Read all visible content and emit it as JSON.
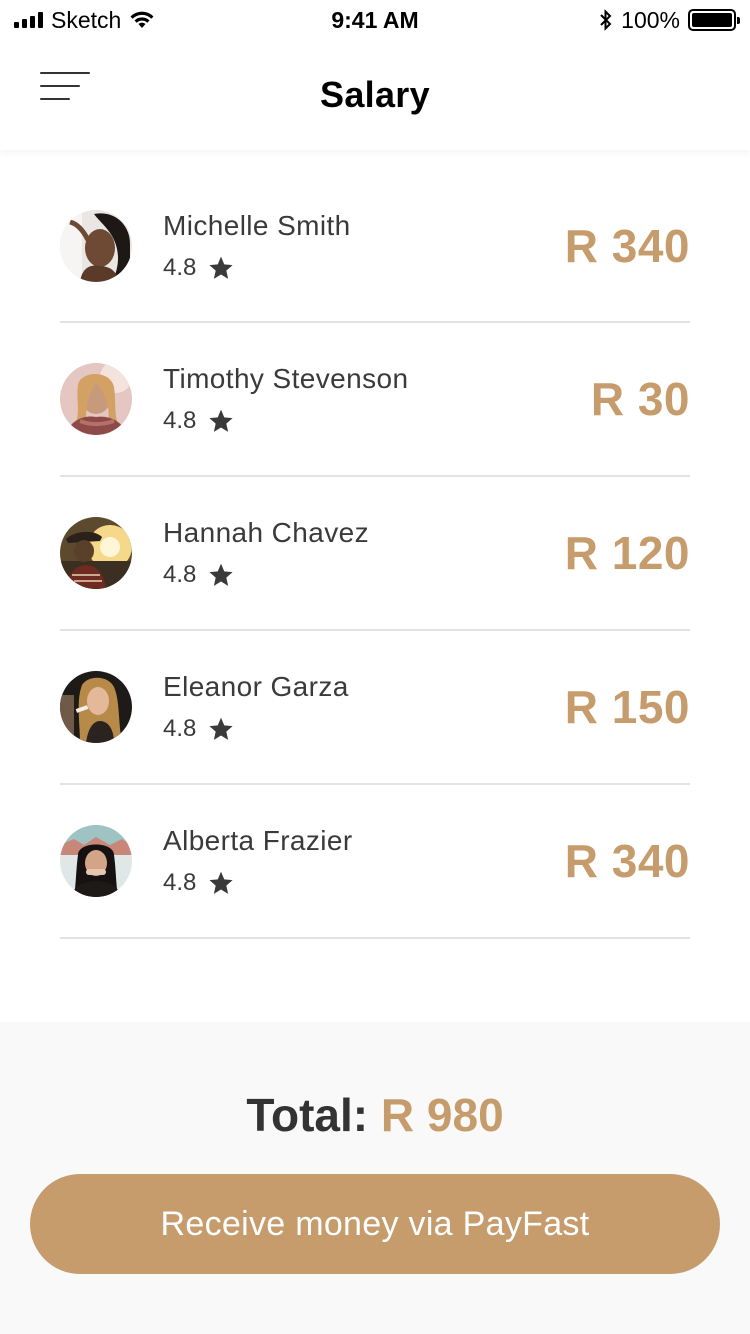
{
  "status_bar": {
    "carrier": "Sketch",
    "time": "9:41 AM",
    "battery_percent": "100%"
  },
  "header": {
    "title": "Salary"
  },
  "colors": {
    "accent": "#c69c6d",
    "text": "#333333",
    "divider": "#e3e3e3"
  },
  "employees": [
    {
      "name": "Michelle Smith",
      "rating": "4.8",
      "amount": "R 340"
    },
    {
      "name": "Timothy Stevenson",
      "rating": "4.8",
      "amount": "R 30"
    },
    {
      "name": "Hannah Chavez",
      "rating": "4.8",
      "amount": "R 120"
    },
    {
      "name": "Eleanor Garza",
      "rating": "4.8",
      "amount": "R 150"
    },
    {
      "name": "Alberta Frazier",
      "rating": "4.8",
      "amount": "R 340"
    }
  ],
  "footer": {
    "total_label": "Total:",
    "total_value": "R 980",
    "button_label": "Receive money via PayFast"
  }
}
